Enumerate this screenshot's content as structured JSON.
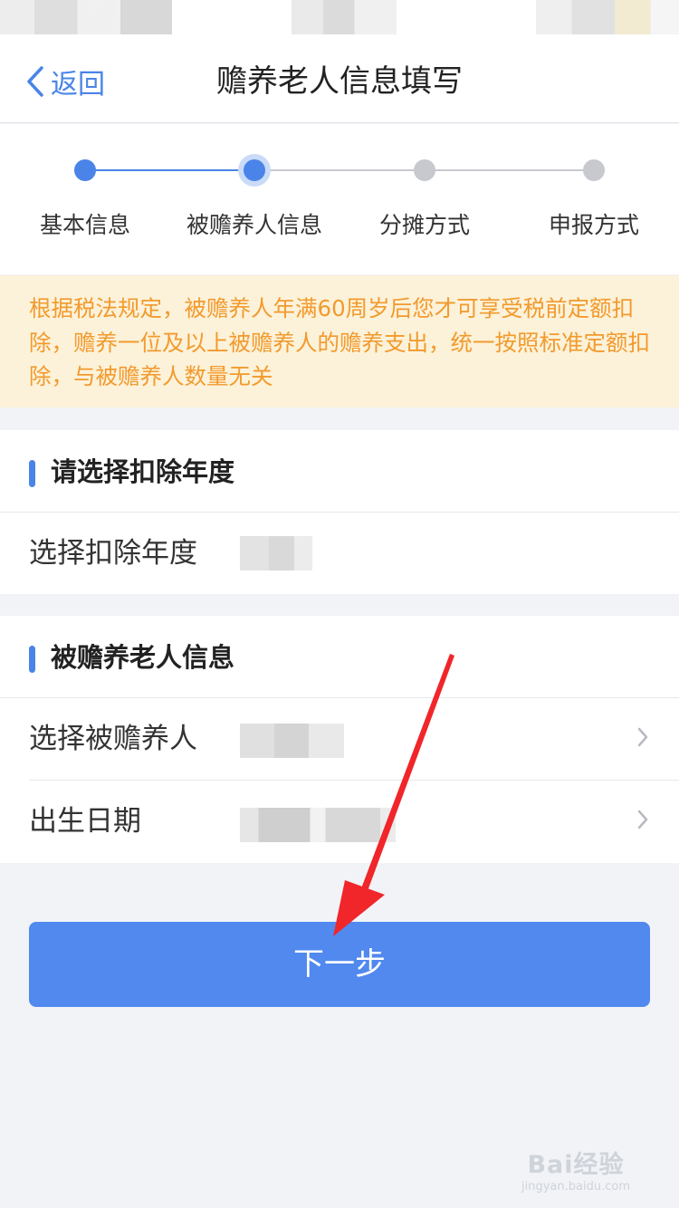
{
  "nav": {
    "back_label": "返回",
    "title": "赡养老人信息填写"
  },
  "steps": [
    {
      "label": "基本信息",
      "state": "done"
    },
    {
      "label": "被赡养人信息",
      "state": "current"
    },
    {
      "label": "分摊方式",
      "state": "todo"
    },
    {
      "label": "申报方式",
      "state": "todo"
    }
  ],
  "notice": "根据税法规定，被赡养人年满60周岁后您才可享受税前定额扣除，赡养一位及以上被赡养人的赡养支出，统一按照标准定额扣除，与被赡养人数量无关",
  "section_year": {
    "title": "请选择扣除年度",
    "row_label": "选择扣除年度"
  },
  "section_elder": {
    "title": "被赡养老人信息",
    "rows": [
      {
        "label": "选择被赡养人"
      },
      {
        "label": "出生日期"
      }
    ]
  },
  "next_button": "下一步",
  "watermark": {
    "main": "Bai经验",
    "sub": "jingyan.baidu.com"
  },
  "colors": {
    "primary": "#4a84e8",
    "button": "#5189ef",
    "notice_bg": "#fcf2d9",
    "notice_text": "#f29a2e",
    "pending_dot": "#c7c9cf",
    "annotation_arrow": "#f0262a"
  }
}
